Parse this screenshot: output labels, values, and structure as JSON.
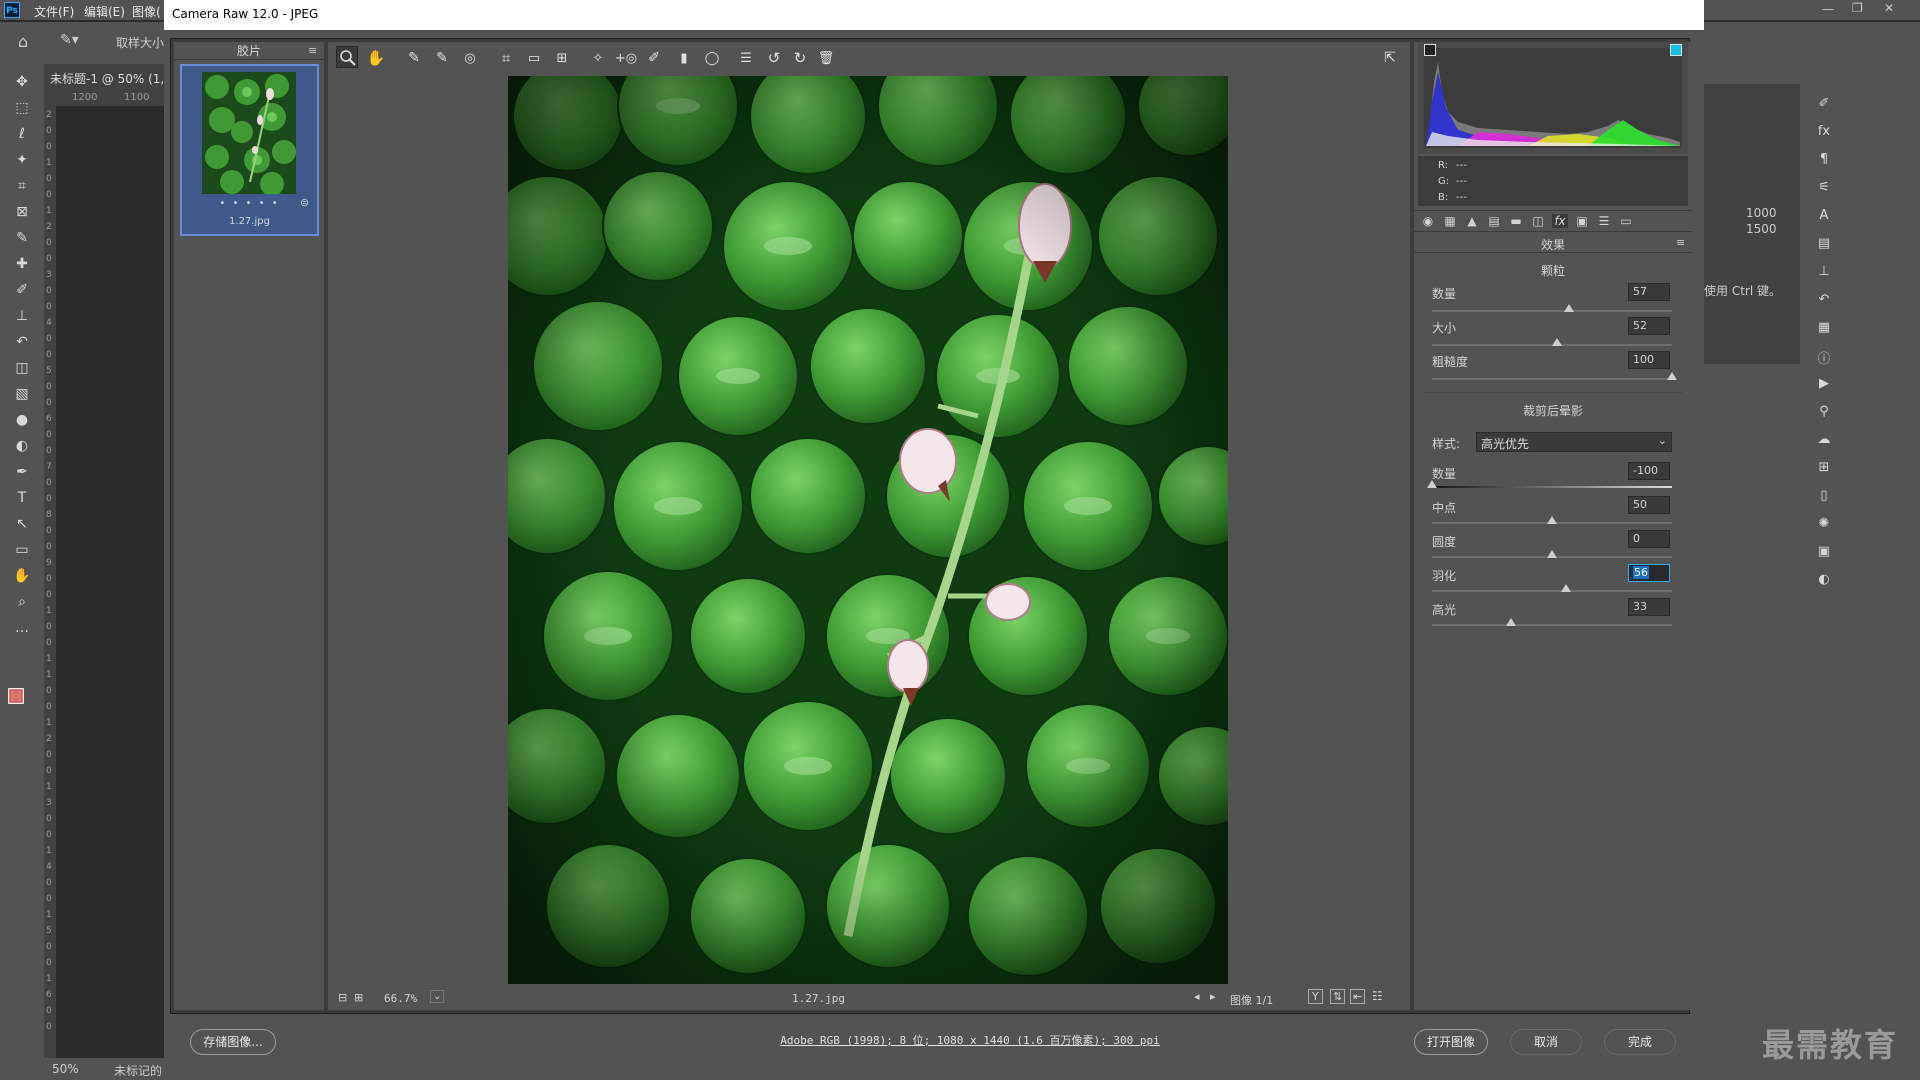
{
  "ps": {
    "menu": [
      "文件(F)",
      "编辑(E)",
      "图像("
    ],
    "opt_label": "取样大小",
    "doc_tab": "未标题-1 @ 50% (1,",
    "ruler_h": [
      "1200",
      "1100"
    ],
    "ruler_v": [
      "2",
      "0",
      "0",
      "1",
      "0",
      "0",
      "1",
      "2",
      "0",
      "0",
      "3",
      "0",
      "0",
      "4",
      "0",
      "0",
      "5",
      "0",
      "0",
      "6",
      "0",
      "0",
      "7",
      "0",
      "0",
      "8",
      "0",
      "0",
      "9",
      "0",
      "0",
      "1",
      "0",
      "0",
      "1",
      "1",
      "0",
      "0",
      "1",
      "2",
      "0",
      "0",
      "1",
      "3",
      "0",
      "0",
      "1",
      "4",
      "0",
      "0",
      "1",
      "5",
      "0",
      "0",
      "1",
      "6",
      "0",
      "0"
    ],
    "zoom": "50%",
    "status": "未标记的 RGB (8bpc)",
    "right_dims": [
      "1000",
      "1500"
    ],
    "right_hint": "使用 Ctrl 键。",
    "accent": "#31a8ff"
  },
  "camera_raw": {
    "title": "Camera Raw 12.0 -  JPEG",
    "filmstrip_title": "胶片",
    "stars": "• • • • •",
    "filename": "1.27.jpg",
    "zoom": "66.7%",
    "viewer_filename": "1.27.jpg",
    "image_count": "图像 1/1",
    "rgb": {
      "r_label": "R:",
      "g_label": "G:",
      "b_label": "B:",
      "r": "---",
      "g": "---",
      "b": "---"
    },
    "panel_title": "效果",
    "grain": {
      "title": "颗粒",
      "amount_label": "数量",
      "amount": "57",
      "amount_pct": 0.57,
      "size_label": "大小",
      "size": "52",
      "size_pct": 0.52,
      "roughness_label": "粗糙度",
      "roughness": "100",
      "roughness_pct": 1.0
    },
    "vignette": {
      "title": "裁剪后晕影",
      "style_label": "样式:",
      "style_value": "高光优先",
      "amount_label": "数量",
      "amount": "-100",
      "amount_pct": 0.0,
      "midpoint_label": "中点",
      "midpoint": "50",
      "midpoint_pct": 0.5,
      "roundness_label": "圆度",
      "roundness": "0",
      "roundness_pct": 0.5,
      "feather_label": "羽化",
      "feather": "56",
      "feather_pct": 0.56,
      "highlights_label": "高光",
      "highlights": "33",
      "highlights_pct": 0.33
    },
    "save_btn": "存储图像...",
    "workflow": "Adobe RGB (1998); 8 位; 1080 x 1440 (1.6 百万像素); 300 ppi",
    "open_btn": "打开图像",
    "cancel_btn": "取消",
    "done_btn": "完成"
  },
  "watermark": "最需教育"
}
